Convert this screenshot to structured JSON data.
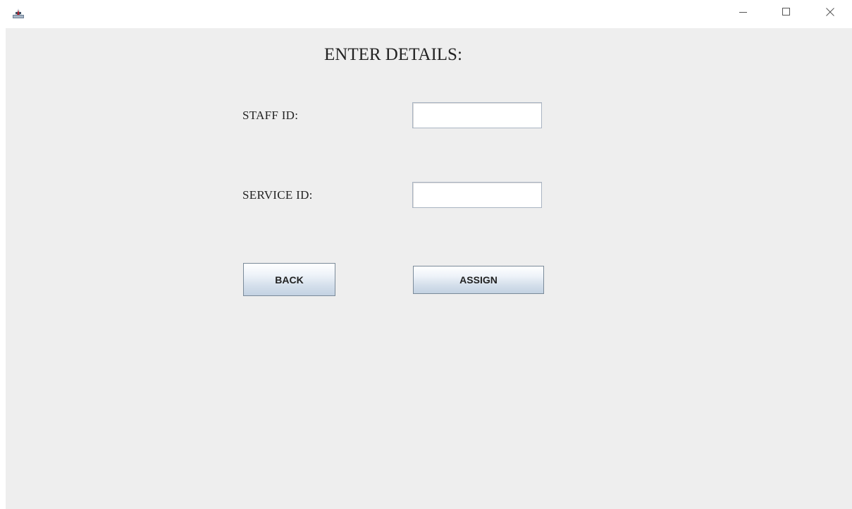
{
  "window": {
    "icons": {
      "app": "java-app-icon",
      "minimize": "minimize-icon",
      "maximize": "maximize-icon",
      "close": "close-icon"
    }
  },
  "form": {
    "heading": "ENTER DETAILS:",
    "staff_id": {
      "label": "STAFF ID:",
      "value": ""
    },
    "service_id": {
      "label": "SERVICE ID:",
      "value": ""
    }
  },
  "buttons": {
    "back_label": "BACK",
    "assign_label": "ASSIGN"
  },
  "colors": {
    "panel_background": "#eeeeee",
    "titlebar_background": "#ffffff",
    "button_border": "#7a8a99",
    "field_border": "#a9b4c2"
  }
}
